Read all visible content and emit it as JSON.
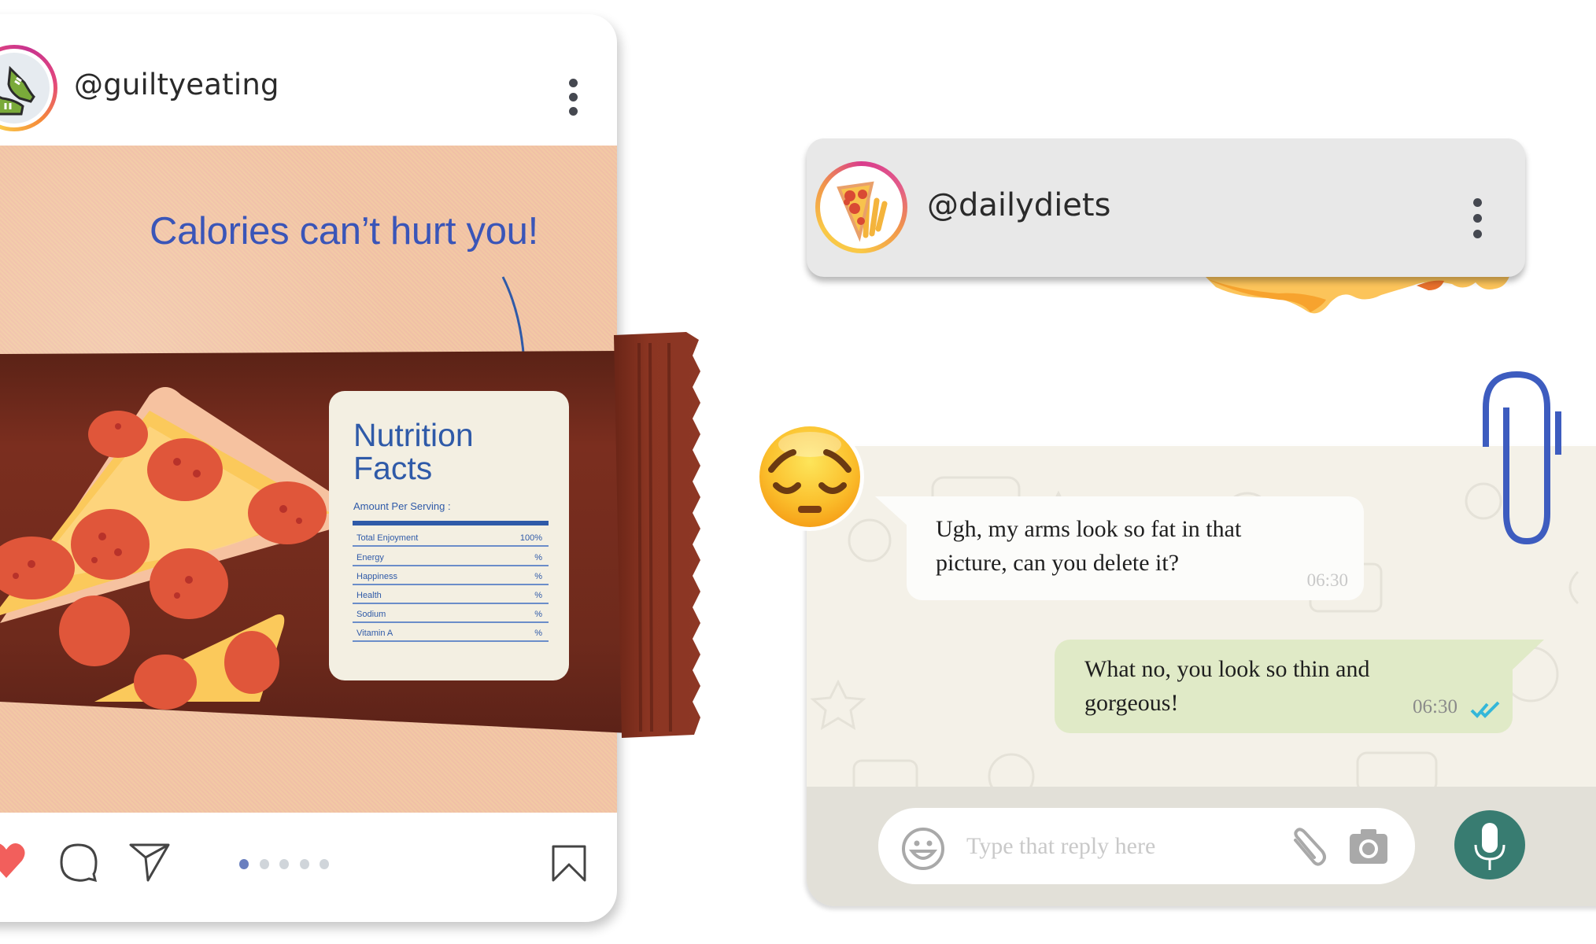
{
  "post": {
    "username": "@guiltyeating",
    "avatar_icon": "sneakers-icon",
    "menu_icon": "more-vertical-icon",
    "headline": "Calories can’t hurt you!",
    "nutrition_label": {
      "title_line1": "Nutrition",
      "title_line2": "Facts",
      "serving": "Amount Per Serving :",
      "rows": [
        {
          "name": "Total Enjoyment",
          "value": "100%"
        },
        {
          "name": "Energy",
          "value": "%"
        },
        {
          "name": "Happiness",
          "value": "%"
        },
        {
          "name": "Health",
          "value": "%"
        },
        {
          "name": "Sodium",
          "value": "%"
        },
        {
          "name": "Vitamin A",
          "value": "%"
        }
      ]
    },
    "actions": {
      "like_icon": "heart-icon",
      "comment_icon": "comment-icon",
      "share_icon": "send-icon",
      "save_icon": "bookmark-icon",
      "liked": true
    },
    "carousel": {
      "total": 5,
      "active": 1
    },
    "colors": {
      "like": "#f25f5c",
      "active_dot": "#6a7fbf",
      "inactive_dot": "#d0d5da",
      "headline": "#3a55b8"
    }
  },
  "chat": {
    "contact_username": "@dailydiets",
    "contact_avatar_icon": "pizza-fries-icon",
    "menu_icon": "more-vertical-icon",
    "sticker_emoji": "😔",
    "messages": [
      {
        "direction": "incoming",
        "text": "Ugh, my arms look so fat in that picture, can you delete it?",
        "time": "06:30"
      },
      {
        "direction": "outgoing",
        "text": "What no, you look so thin and gorgeous!",
        "time": "06:30",
        "status": "read"
      }
    ],
    "composer": {
      "placeholder": "Type that reply here",
      "value": "",
      "emoji_icon": "smiley-icon",
      "attach_icon": "paperclip-icon",
      "camera_icon": "camera-icon",
      "mic_icon": "microphone-icon"
    },
    "colors": {
      "outgoing_bubble": "#e0eac7",
      "incoming_bubble": "#fcfcfa",
      "mic_button": "#387c71",
      "read_ticks": "#34b7d9"
    }
  }
}
